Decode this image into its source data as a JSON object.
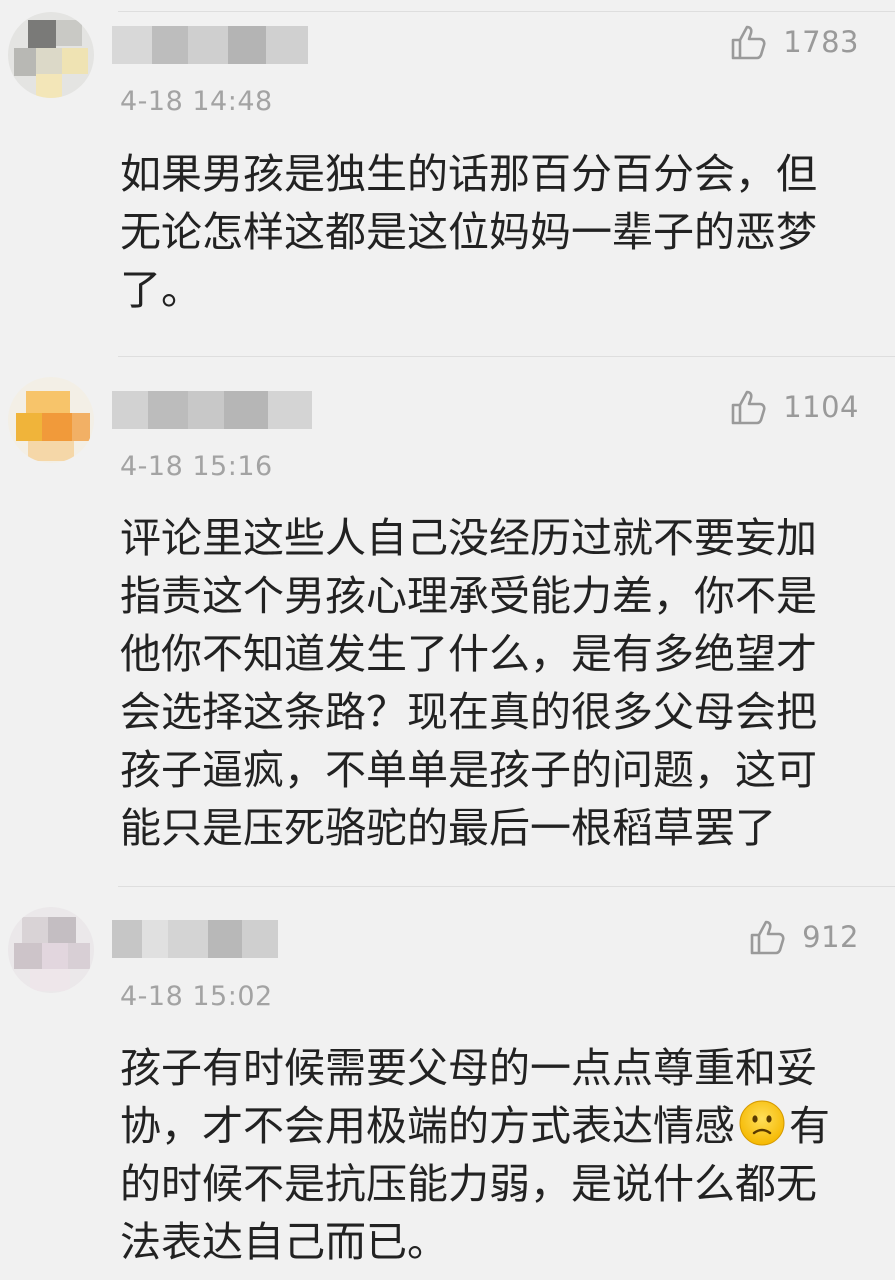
{
  "comments": [
    {
      "likes": "1783",
      "timestamp": "4-18 14:48",
      "text": "如果男孩是独生的话那百分百分会，但\n无论怎样这都是这位妈妈一辈子的恶梦\n了。"
    },
    {
      "likes": "1104",
      "timestamp": "4-18 15:16",
      "text": "评论里这些人自己没经历过就不要妄加\n指责这个男孩心理承受能力差，你不是\n他你不知道发生了什么，是有多绝望才\n会选择这条路？现在真的很多父母会把\n孩子逼疯，不单单是孩子的问题，这可\n能只是压死骆驼的最后一根稻草罢了"
    },
    {
      "likes": "912",
      "timestamp": "4-18 15:02",
      "text_before_emoji": "孩子有时候需要父母的一点点尊重和妥\n协，才不会用极端的方式表达情感",
      "text_after_emoji": "有\n的时候不是抗压能力弱，是说什么都无\n法表达自己而已。"
    }
  ],
  "icons": {
    "like": "thumbs-up-icon",
    "emoji": "confused-face-emoji"
  },
  "colors": {
    "background": "#f1f1f1",
    "text": "#222222",
    "meta": "#9a9a9a",
    "divider": "#dedede"
  }
}
